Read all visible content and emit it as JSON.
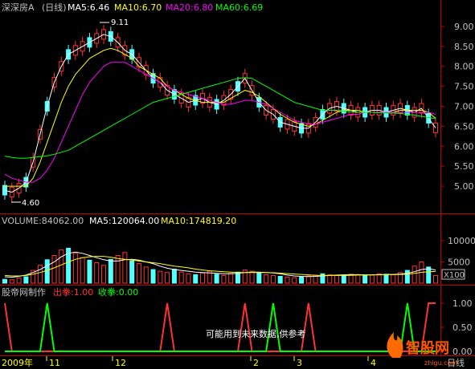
{
  "header": {
    "stock_name": "深深房A",
    "period": "(日线)",
    "ma5": "MA5:6.46",
    "ma10": "MA10:6.70",
    "ma20": "MA20:6.80",
    "ma60": "MA60:6.69"
  },
  "price_annotations": {
    "high": "9.11",
    "low": "4.60"
  },
  "volume_header": {
    "volume": "VOLUME:84062.00",
    "ma5": "MA5:120064.00",
    "ma10": "MA10:174819.20"
  },
  "volume_scale_label": "X100",
  "indicator_header": {
    "name": "股帝网制作",
    "out": "出拳:1.00",
    "back": "收拳:0.00"
  },
  "indicator_note": "可能用到未来数据,供参考",
  "x_axis": {
    "year": "2009年",
    "months": [
      "11",
      "12",
      "2",
      "3",
      "4"
    ],
    "period_label": "日线"
  },
  "watermark": {
    "text": "智股网",
    "url": "zhigu.com"
  },
  "colors": {
    "up": "#ff3232",
    "down": "#54ffff",
    "ma5": "#ffffff",
    "ma10": "#ffff00",
    "ma20": "#ff00ff",
    "ma60": "#00ff00",
    "frame": "#c00000",
    "text": "#c0c0c0"
  },
  "chart_data": [
    {
      "type": "line",
      "title": "深深房A (日线)",
      "y_ticks": [
        "9.00",
        "8.50",
        "8.00",
        "7.50",
        "7.00",
        "6.50",
        "6.00",
        "5.50",
        "5.00"
      ],
      "ylim": [
        4.4,
        9.3
      ],
      "series": [
        {
          "name": "MA5",
          "values": [
            4.9,
            4.85,
            4.95,
            5.1,
            5.6,
            6.3,
            7.0,
            7.6,
            8.0,
            8.3,
            8.4,
            8.5,
            8.6,
            8.7,
            8.8,
            8.75,
            8.6,
            8.4,
            8.3,
            8.1,
            7.9,
            7.7,
            7.6,
            7.4,
            7.3,
            7.2,
            7.1,
            7.15,
            7.2,
            7.1,
            7.05,
            7.15,
            7.3,
            7.5,
            7.7,
            7.4,
            7.1,
            6.9,
            6.8,
            6.6,
            6.55,
            6.5,
            6.45,
            6.45,
            6.6,
            6.8,
            6.95,
            7.0,
            6.95,
            6.9,
            6.85,
            6.85,
            6.9,
            6.9,
            6.85,
            6.9,
            6.95,
            6.9,
            6.85,
            6.95,
            6.7,
            6.46
          ]
        },
        {
          "name": "MA10",
          "values": [
            5.0,
            5.0,
            5.0,
            5.0,
            5.2,
            5.6,
            6.1,
            6.6,
            7.1,
            7.5,
            7.8,
            8.0,
            8.2,
            8.3,
            8.4,
            8.45,
            8.4,
            8.3,
            8.2,
            8.0,
            7.9,
            7.8,
            7.7,
            7.5,
            7.4,
            7.3,
            7.2,
            7.15,
            7.1,
            7.1,
            7.1,
            7.1,
            7.2,
            7.3,
            7.4,
            7.35,
            7.25,
            7.1,
            6.95,
            6.8,
            6.7,
            6.6,
            6.55,
            6.5,
            6.55,
            6.65,
            6.75,
            6.85,
            6.9,
            6.9,
            6.9,
            6.85,
            6.85,
            6.85,
            6.85,
            6.85,
            6.9,
            6.9,
            6.9,
            6.9,
            6.85,
            6.7
          ]
        },
        {
          "name": "MA20",
          "values": [
            5.3,
            5.2,
            5.15,
            5.1,
            5.1,
            5.2,
            5.4,
            5.7,
            6.1,
            6.5,
            6.9,
            7.3,
            7.6,
            7.8,
            8.0,
            8.1,
            8.1,
            8.1,
            8.0,
            7.9,
            7.8,
            7.7,
            7.6,
            7.5,
            7.4,
            7.35,
            7.3,
            7.25,
            7.2,
            7.15,
            7.1,
            7.05,
            7.05,
            7.1,
            7.15,
            7.15,
            7.1,
            7.05,
            6.95,
            6.85,
            6.75,
            6.65,
            6.6,
            6.55,
            6.55,
            6.6,
            6.65,
            6.7,
            6.75,
            6.8,
            6.8,
            6.85,
            6.85,
            6.85,
            6.85,
            6.85,
            6.85,
            6.85,
            6.85,
            6.85,
            6.85,
            6.8
          ]
        },
        {
          "name": "MA60",
          "values": [
            5.75,
            5.72,
            5.7,
            5.7,
            5.72,
            5.74,
            5.76,
            5.8,
            5.85,
            5.9,
            6.0,
            6.1,
            6.2,
            6.3,
            6.4,
            6.5,
            6.6,
            6.7,
            6.8,
            6.9,
            7.0,
            7.1,
            7.15,
            7.2,
            7.25,
            7.3,
            7.35,
            7.4,
            7.45,
            7.5,
            7.55,
            7.6,
            7.65,
            7.7,
            7.72,
            7.7,
            7.6,
            7.5,
            7.4,
            7.3,
            7.2,
            7.1,
            7.05,
            7.0,
            6.95,
            6.9,
            6.9,
            6.9,
            6.88,
            6.86,
            6.85,
            6.85,
            6.85,
            6.84,
            6.83,
            6.83,
            6.82,
            6.8,
            6.78,
            6.75,
            6.72,
            6.69
          ]
        }
      ]
    },
    {
      "type": "bar",
      "title": "VOLUME",
      "y_ticks": [
        "10000",
        "5000"
      ],
      "ylim": [
        0,
        13000
      ],
      "values": [
        900,
        800,
        1200,
        1500,
        3000,
        4200,
        5500,
        6500,
        7800,
        8200,
        7000,
        6000,
        5400,
        4800,
        4200,
        5600,
        6500,
        7200,
        5200,
        4600,
        3800,
        3200,
        2800,
        2500,
        3300,
        2600,
        2200,
        2000,
        2400,
        2800,
        2100,
        1800,
        2300,
        2600,
        3100,
        2800,
        2400,
        2000,
        1800,
        1600,
        1400,
        1300,
        1500,
        1700,
        1900,
        2200,
        2000,
        1800,
        1900,
        2100,
        2000,
        1800,
        1900,
        2200,
        2100,
        2000,
        2500,
        3000,
        4000,
        5000,
        3800,
        1800
      ],
      "series": [
        {
          "name": "MA5",
          "values": [
            1500,
            1400,
            1600,
            1900,
            2500,
            3200,
            4100,
            5000,
            6200,
            7000,
            7300,
            7000,
            6500,
            6000,
            5500,
            5200,
            5200,
            5500,
            5600,
            5400,
            5000,
            4600,
            4000,
            3500,
            3200,
            3000,
            2800,
            2600,
            2500,
            2400,
            2300,
            2200,
            2200,
            2300,
            2500,
            2600,
            2600,
            2500,
            2400,
            2200,
            1900,
            1700,
            1600,
            1550,
            1600,
            1700,
            1800,
            1900,
            1950,
            2000,
            2000,
            1950,
            1950,
            2000,
            2050,
            2050,
            2150,
            2300,
            2700,
            3200,
            3400,
            3100
          ]
        },
        {
          "name": "MA10",
          "values": [
            1800,
            1700,
            1700,
            1800,
            2100,
            2500,
            3000,
            3600,
            4300,
            5000,
            5600,
            6000,
            6200,
            6300,
            6300,
            6100,
            5800,
            5600,
            5400,
            5200,
            5000,
            4800,
            4600,
            4300,
            4000,
            3800,
            3600,
            3300,
            3100,
            2900,
            2800,
            2700,
            2600,
            2500,
            2500,
            2500,
            2500,
            2500,
            2450,
            2350,
            2250,
            2150,
            2050,
            1950,
            1850,
            1800,
            1800,
            1800,
            1800,
            1850,
            1900,
            1900,
            1950,
            1950,
            2000,
            2000,
            2050,
            2100,
            2300,
            2550,
            2700,
            2750
          ]
        }
      ]
    },
    {
      "type": "line",
      "title": "股帝网制作",
      "y_ticks": [
        "1.00",
        "0.50",
        "0.00"
      ],
      "ylim": [
        -0.05,
        1.1
      ],
      "series": [
        {
          "name": "出拳",
          "values": [
            1,
            0,
            0,
            0,
            0,
            0,
            0,
            0,
            0,
            0,
            0,
            0,
            0,
            0,
            0,
            0,
            0,
            0,
            0,
            0,
            0,
            0,
            0,
            1,
            0,
            0,
            0,
            0,
            0,
            0,
            0,
            0,
            0,
            0,
            1,
            0,
            0,
            0,
            0,
            0,
            0,
            0,
            0,
            1,
            0,
            0,
            0,
            0,
            0,
            0,
            0,
            0,
            0,
            0,
            0,
            0,
            0,
            0,
            0,
            0,
            1,
            1
          ]
        },
        {
          "name": "收拳",
          "values": [
            0,
            0,
            0,
            0,
            0,
            0,
            1,
            0,
            0,
            0,
            0,
            0,
            0,
            0,
            0,
            0,
            0,
            0,
            0,
            0,
            0,
            0,
            0,
            0,
            0,
            0,
            0,
            0,
            0,
            0,
            0,
            0,
            0,
            0,
            0,
            0,
            0,
            0,
            1,
            0,
            0,
            0,
            0,
            0,
            0,
            0,
            0,
            0,
            0,
            0,
            0,
            0,
            0,
            0,
            0,
            0,
            0,
            1,
            0,
            0,
            0,
            0
          ]
        }
      ]
    }
  ]
}
